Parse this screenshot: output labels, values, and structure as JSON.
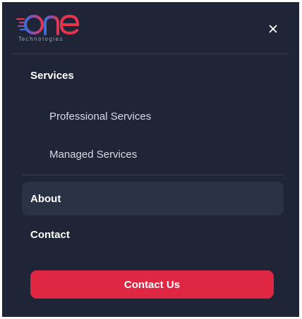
{
  "logo": {
    "wordmark": "one",
    "subtitle": "Technologies"
  },
  "header": {
    "close_icon": "close-icon"
  },
  "nav": {
    "services": "Services",
    "professional_services": "Professional Services",
    "managed_services": "Managed Services",
    "about": "About",
    "contact": "Contact"
  },
  "cta": {
    "label": "Contact Us"
  },
  "colors": {
    "panel_background": "#1f2536",
    "active_row": "#2b3246",
    "accent": "#df2744",
    "logo_gradient_start": "#3b6fd8",
    "logo_gradient_end": "#e5344b"
  }
}
